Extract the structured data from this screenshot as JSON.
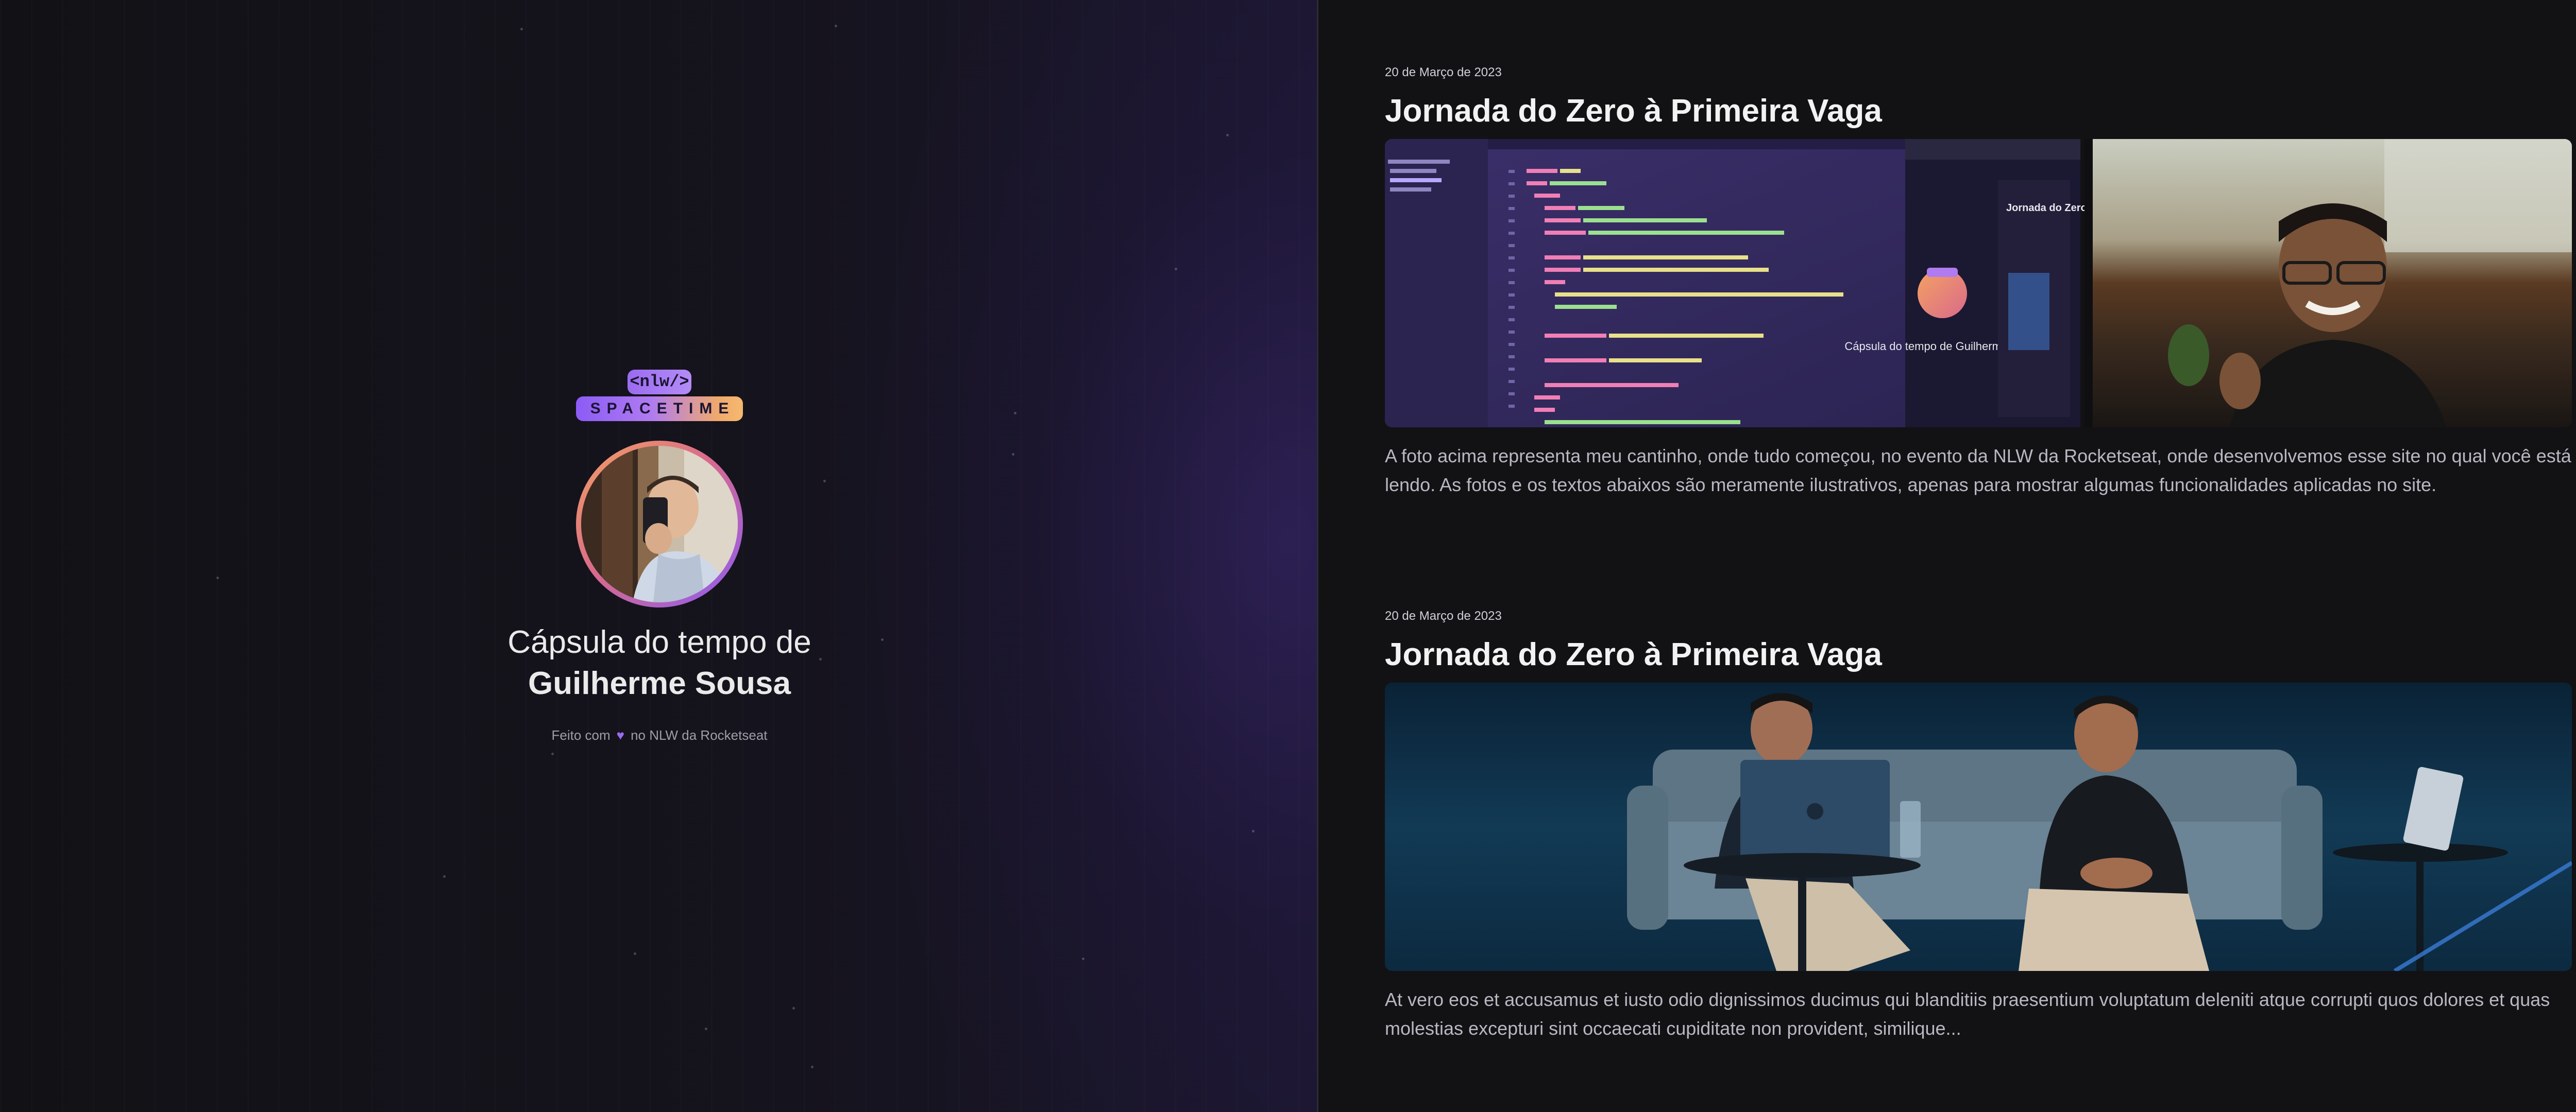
{
  "sidebar": {
    "logo_tag": "<nlw/>",
    "logo_word": "SPACETIME",
    "title_line1": "Cápsula do tempo de",
    "title_line2": "Guilherme Sousa",
    "made_with_before": "Feito com",
    "heart_glyph": "♥",
    "made_with_after": "no NLW da Rocketseat",
    "accent_color": "#8b5cf6",
    "avatar_icon": "profile-photo"
  },
  "memories": [
    {
      "date": "20 de Março de 2023",
      "title": "Jornada do Zero à Primeira Vaga",
      "text": "A foto acima representa meu cantinho, onde tudo começou, no evento da NLW da Rocketseat, onde desenvolvemos esse site no qual você está lendo. As fotos e os textos abaixos são meramente ilustrativos, apenas para mostrar algumas funcionalidades aplicadas no site.",
      "image_icon": "code-editor-and-webcam-photo",
      "image_texts": {
        "mini_title": "Cápsula do tempo de Guilherme Sousa",
        "mini_heading": "Jornada do Zero à Primeira Vaga"
      }
    },
    {
      "date": "20 de Março de 2023",
      "title": "Jornada do Zero à Primeira Vaga",
      "text": "At vero eos et accusamus et iusto odio dignissimos ducimus qui blanditiis praesentium voluptatum deleniti atque corrupti quos dolores et quas molestias excepturi sint occaecati cupiditate non provident, similique...",
      "image_icon": "event-stage-photo"
    }
  ]
}
